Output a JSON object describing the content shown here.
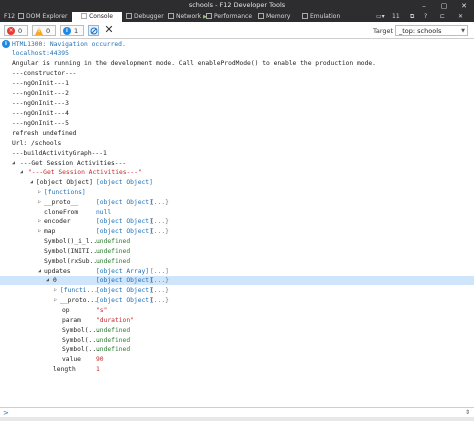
{
  "window": {
    "title": "schools - F12 Developer Tools"
  },
  "tabs": [
    {
      "label": "F12"
    },
    {
      "label": "DOM Explorer"
    },
    {
      "label": "Console"
    },
    {
      "label": "Debugger"
    },
    {
      "label": "Network"
    },
    {
      "label": "Performance"
    },
    {
      "label": "Memory"
    },
    {
      "label": "Emulation"
    }
  ],
  "tab_right": {
    "count": "11"
  },
  "toolbar": {
    "errors": "0",
    "warnings": "0",
    "messages": "1",
    "target_label": "Target",
    "target_value": "_top: schools"
  },
  "colors": {
    "accent": "#1e6fb8",
    "error": "#e53935",
    "warning": "#f9a825",
    "info": "#1e88e5",
    "highlight": "#cfe5fb"
  },
  "console_lines": [
    {
      "text": "HTML1300: Navigation occurred."
    },
    {
      "text": "localhost:44395"
    },
    {
      "text": "Angular is running in the development mode. Call enableProdMode() to enable the production mode."
    },
    {
      "text": "---constructor---"
    },
    {
      "text": "---ngOnInit---1"
    },
    {
      "text": "---ngOnInit---2"
    },
    {
      "text": "---ngOnInit---3"
    },
    {
      "text": "---ngOnInit---4"
    },
    {
      "text": "---ngOnInit---5"
    },
    {
      "text": "refresh undefined"
    },
    {
      "text": "Url: /schools"
    },
    {
      "text": "---buildActivityGraph---1"
    },
    {
      "text": "---Get Session Activities---"
    },
    {
      "text": "\"---Get Session Activities---\""
    },
    {
      "text": "[object Object]",
      "value": "[object Object]"
    },
    {
      "text": "[functions]"
    },
    {
      "text": "__proto__",
      "value": "[object Object]",
      "value2": "{...}"
    },
    {
      "text": "cloneFrom",
      "value": "null"
    },
    {
      "text": "encoder",
      "value": "[object Object]",
      "value2": "{...}"
    },
    {
      "text": "map",
      "value": "[object Object]",
      "value2": "{...}"
    },
    {
      "text": "Symbol()_i_l...",
      "value": "undefined"
    },
    {
      "text": "Symbol(INITI...",
      "value": "undefined"
    },
    {
      "text": "Symbol(rxSub...",
      "value": "undefined"
    },
    {
      "text": "updates",
      "value": "[object Array]",
      "value2": "[...]"
    },
    {
      "text": "0",
      "value": "[object Object]",
      "value2": "{...}"
    },
    {
      "text": "[functi...",
      "value": "[object Object]",
      "value2": "{...}"
    },
    {
      "text": "__proto...",
      "value": "[object Object]",
      "value2": "{...}"
    },
    {
      "text": "op",
      "value": "\"s\""
    },
    {
      "text": "param",
      "value": "\"duration\""
    },
    {
      "text": "Symbol(...",
      "value": "undefined"
    },
    {
      "text": "Symbol(...",
      "value": "undefined"
    },
    {
      "text": "Symbol(...",
      "value": "undefined"
    },
    {
      "text": "value",
      "value": "90"
    },
    {
      "text": "length",
      "value": "1"
    }
  ],
  "input": {
    "prompt": ">",
    "expand": "⇕"
  }
}
